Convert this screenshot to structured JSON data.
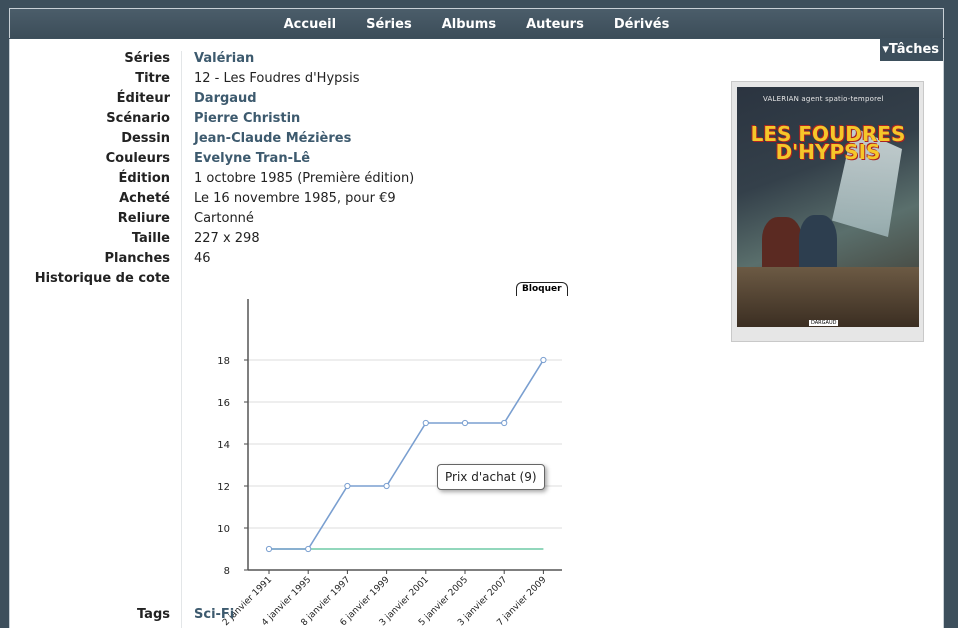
{
  "nav": {
    "items": [
      "Accueil",
      "Séries",
      "Albums",
      "Auteurs",
      "Dérivés"
    ]
  },
  "tasks_label": "▾Tâches",
  "details": {
    "labels": [
      "Séries",
      "Titre",
      "Éditeur",
      "Scénario",
      "Dessin",
      "Couleurs",
      "Édition",
      "Acheté",
      "Reliure",
      "Taille",
      "Planches",
      "Historique de cote"
    ],
    "series": "Valérian",
    "title": "12 - Les Foudres d'Hypsis",
    "publisher": "Dargaud",
    "writer": "Pierre Christin",
    "artist": "Jean-Claude Mézières",
    "colorist": "Evelyne Tran-Lê",
    "edition": "1 octobre 1985 (Première édition)",
    "bought": "Le 16 novembre 1985, pour €9",
    "binding": "Cartonné",
    "size": "227 x 298",
    "pages": "46"
  },
  "tags": {
    "label": "Tags",
    "value": "Sci-Fi"
  },
  "cover": {
    "series_line": "VALERIAN agent spatio-temporel",
    "title": "LES FOUDRES D'HYPSIS",
    "publisher": "DARGAUD"
  },
  "chart": {
    "lock_label": "Bloquer",
    "tooltip": "Prix d'achat (9)"
  },
  "chart_data": {
    "type": "line",
    "categories": [
      "2 janvier 1991",
      "4 janvier 1995",
      "8 janvier 1997",
      "6 janvier 1999",
      "3 janvier 2001",
      "5 janvier 2005",
      "3 janvier 2007",
      "7 janvier 2009"
    ],
    "series": [
      {
        "values": [
          9,
          9,
          12,
          12,
          15,
          15,
          15,
          18
        ],
        "color": "#7a9fd0"
      },
      {
        "name": "Prix d'achat",
        "values": [
          9,
          9,
          9,
          9,
          9,
          9,
          9,
          9
        ],
        "color": "#6fcaa5"
      }
    ],
    "ylim": [
      8,
      19
    ],
    "yticks": [
      8,
      10,
      12,
      14,
      16,
      18
    ],
    "grid": true
  }
}
